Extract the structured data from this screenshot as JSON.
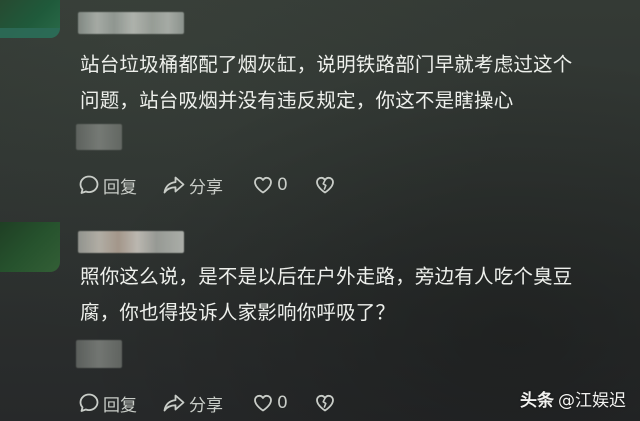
{
  "comments": [
    {
      "lines": [
        "站台垃圾桶都配了烟灰缸，说明铁路部门早就考虑过这个",
        "问题，站台吸烟并没有违反规定，你这不是瞎操心"
      ],
      "actions": {
        "reply_label": "回复",
        "share_label": "分享",
        "like_count": "0"
      }
    },
    {
      "lines": [
        "照你这么说，是不是以后在户外走路，旁边有人吃个臭豆",
        "腐，你也得投诉人家影响你呼吸了？"
      ],
      "actions": {
        "reply_label": "回复",
        "share_label": "分享",
        "like_count": "0"
      }
    }
  ],
  "watermark": {
    "brand": "头条",
    "handle": "@江娱迟"
  },
  "icons": {
    "reply": "comment-bubble-icon",
    "share": "share-arrow-icon",
    "like": "heart-icon",
    "dislike": "broken-heart-icon"
  }
}
